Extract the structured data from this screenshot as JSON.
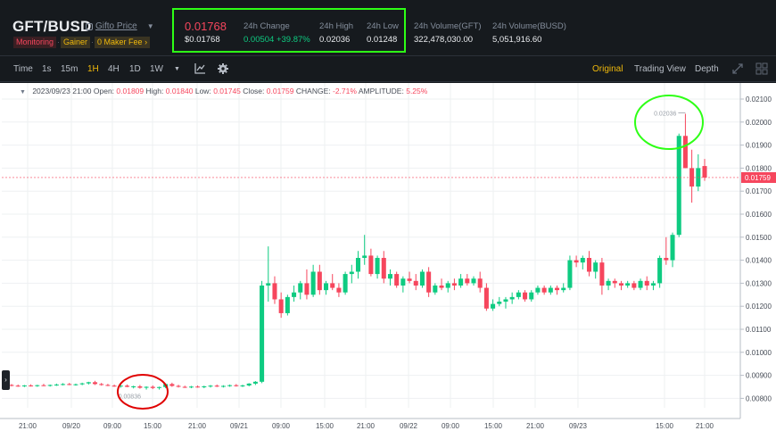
{
  "header": {
    "pair": "GFT/BUSD",
    "coin_name": "Gifto Price",
    "tags": {
      "monitoring": "Monitoring",
      "gainer": "Gainer",
      "fee": "0 Maker Fee"
    },
    "price": "0.01768",
    "price_usd": "$0.01768",
    "change_label": "24h Change",
    "change_value": "0.00504 +39.87%",
    "high_label": "24h High",
    "high_value": "0.02036",
    "low_label": "24h Low",
    "low_value": "0.01248",
    "vol_gft_label": "24h Volume(GFT)",
    "vol_gft_value": "322,478,030.00",
    "vol_busd_label": "24h Volume(BUSD)",
    "vol_busd_value": "5,051,916.60"
  },
  "toolbar": {
    "intervals": [
      "Time",
      "1s",
      "15m",
      "1H",
      "4H",
      "1D",
      "1W"
    ],
    "active_interval": "1H",
    "views": [
      "Original",
      "Trading View",
      "Depth"
    ],
    "active_view": "Original"
  },
  "ohlc_bar": {
    "date": "2023/09/23 21:00",
    "open_label": "Open:",
    "open": "0.01809",
    "high_label": "High:",
    "high": "0.01840",
    "low_label": "Low:",
    "low": "0.01745",
    "close_label": "Close:",
    "close": "0.01759",
    "change_label": "CHANGE:",
    "change": "-2.71%",
    "amplitude_label": "AMPLITUDE:",
    "amplitude": "5.25%"
  },
  "colors": {
    "up": "#0ecb81",
    "down": "#f6465d",
    "highlight": "#2eff16",
    "annotation_red": "#e00000"
  },
  "chart_data": {
    "type": "candlestick",
    "y_ticks": [
      "0.02100",
      "0.02000",
      "0.01900",
      "0.01800",
      "0.01700",
      "0.01600",
      "0.01500",
      "0.01400",
      "0.01300",
      "0.01200",
      "0.01100",
      "0.01000",
      "0.00900",
      "0.00800"
    ],
    "ylim": [
      0.0077,
      0.0213
    ],
    "x_ticks": [
      "21:00",
      "09/20",
      "09:00",
      "15:00",
      "21:00",
      "09/21",
      "09:00",
      "15:00",
      "21:00",
      "09/22",
      "09:00",
      "15:00",
      "21:00",
      "09/23",
      "15:00",
      "21:00"
    ],
    "current_price_label": "0.01759",
    "high_marker_label": "0.02036",
    "low_marker_label": "0.00836",
    "candles": [
      [
        0.00858,
        0.00862,
        0.00852,
        0.00855
      ],
      [
        0.00855,
        0.0086,
        0.0085,
        0.00853
      ],
      [
        0.00853,
        0.00858,
        0.00849,
        0.00856
      ],
      [
        0.00856,
        0.00861,
        0.00851,
        0.00854
      ],
      [
        0.00854,
        0.00859,
        0.0085,
        0.00857
      ],
      [
        0.00857,
        0.00863,
        0.00853,
        0.00855
      ],
      [
        0.00855,
        0.0086,
        0.00851,
        0.00858
      ],
      [
        0.00858,
        0.00864,
        0.00854,
        0.0086
      ],
      [
        0.0086,
        0.00866,
        0.00856,
        0.00862
      ],
      [
        0.00862,
        0.00867,
        0.00857,
        0.00859
      ],
      [
        0.00859,
        0.00864,
        0.00855,
        0.00861
      ],
      [
        0.00861,
        0.00868,
        0.00857,
        0.00865
      ],
      [
        0.00865,
        0.00872,
        0.0086,
        0.0087
      ],
      [
        0.0087,
        0.00876,
        0.00858,
        0.00862
      ],
      [
        0.00862,
        0.00867,
        0.00855,
        0.00858
      ],
      [
        0.00858,
        0.00863,
        0.00853,
        0.00855
      ],
      [
        0.00855,
        0.0086,
        0.0085,
        0.00852
      ],
      [
        0.00852,
        0.00858,
        0.00846,
        0.00855
      ],
      [
        0.00855,
        0.0086,
        0.00848,
        0.0085
      ],
      [
        0.0085,
        0.00855,
        0.00843,
        0.00852
      ],
      [
        0.00852,
        0.00858,
        0.00842,
        0.00846
      ],
      [
        0.00846,
        0.00852,
        0.00838,
        0.0085
      ],
      [
        0.0085,
        0.00856,
        0.0084,
        0.00845
      ],
      [
        0.00845,
        0.00851,
        0.00838,
        0.00849
      ],
      [
        0.00849,
        0.00865,
        0.00844,
        0.00862
      ],
      [
        0.00862,
        0.00868,
        0.0085,
        0.00854
      ],
      [
        0.00854,
        0.00859,
        0.00847,
        0.0085
      ],
      [
        0.0085,
        0.00855,
        0.00845,
        0.00848
      ],
      [
        0.00848,
        0.00854,
        0.00844,
        0.00851
      ],
      [
        0.00851,
        0.00856,
        0.00846,
        0.00849
      ],
      [
        0.00849,
        0.00855,
        0.00844,
        0.00852
      ],
      [
        0.00852,
        0.00858,
        0.00847,
        0.00855
      ],
      [
        0.00855,
        0.0086,
        0.00849,
        0.00851
      ],
      [
        0.00851,
        0.00857,
        0.00847,
        0.00854
      ],
      [
        0.00854,
        0.0086,
        0.0085,
        0.00857
      ],
      [
        0.00857,
        0.00862,
        0.00851,
        0.00853
      ],
      [
        0.00853,
        0.00859,
        0.00849,
        0.00856
      ],
      [
        0.00856,
        0.00866,
        0.00852,
        0.00864
      ],
      [
        0.00864,
        0.00875,
        0.00858,
        0.00872
      ],
      [
        0.00872,
        0.0131,
        0.00866,
        0.0129
      ],
      [
        0.0129,
        0.0146,
        0.0122,
        0.013
      ],
      [
        0.013,
        0.0133,
        0.0121,
        0.0123
      ],
      [
        0.0123,
        0.0126,
        0.0115,
        0.0117
      ],
      [
        0.0117,
        0.0125,
        0.0116,
        0.0124
      ],
      [
        0.0124,
        0.0129,
        0.0122,
        0.0126
      ],
      [
        0.0126,
        0.0131,
        0.0123,
        0.013
      ],
      [
        0.013,
        0.0136,
        0.0123,
        0.0125
      ],
      [
        0.0125,
        0.0138,
        0.0124,
        0.0135
      ],
      [
        0.0135,
        0.0138,
        0.0125,
        0.0127
      ],
      [
        0.0127,
        0.0131,
        0.0125,
        0.013
      ],
      [
        0.013,
        0.0134,
        0.0127,
        0.0128
      ],
      [
        0.0128,
        0.013,
        0.0124,
        0.0126
      ],
      [
        0.0126,
        0.0135,
        0.0125,
        0.0134
      ],
      [
        0.0134,
        0.0138,
        0.013,
        0.0135
      ],
      [
        0.0135,
        0.0144,
        0.0132,
        0.0141
      ],
      [
        0.0141,
        0.0151,
        0.0138,
        0.0142
      ],
      [
        0.0142,
        0.0145,
        0.0133,
        0.0134
      ],
      [
        0.0134,
        0.0142,
        0.0132,
        0.0141
      ],
      [
        0.0141,
        0.0144,
        0.013,
        0.0132
      ],
      [
        0.0132,
        0.0136,
        0.0129,
        0.0134
      ],
      [
        0.0134,
        0.0135,
        0.0128,
        0.0129
      ],
      [
        0.0129,
        0.0133,
        0.0126,
        0.0132
      ],
      [
        0.0132,
        0.0135,
        0.013,
        0.0131
      ],
      [
        0.0131,
        0.0134,
        0.0127,
        0.0129
      ],
      [
        0.0129,
        0.0136,
        0.0128,
        0.0135
      ],
      [
        0.0135,
        0.0137,
        0.0124,
        0.0126
      ],
      [
        0.0126,
        0.013,
        0.0125,
        0.0129
      ],
      [
        0.0129,
        0.0132,
        0.0127,
        0.0128
      ],
      [
        0.0128,
        0.0131,
        0.0126,
        0.013
      ],
      [
        0.013,
        0.0132,
        0.0127,
        0.0129
      ],
      [
        0.0129,
        0.0134,
        0.0128,
        0.0132
      ],
      [
        0.0132,
        0.0134,
        0.0129,
        0.013
      ],
      [
        0.013,
        0.0133,
        0.0129,
        0.0132
      ],
      [
        0.0132,
        0.0135,
        0.0126,
        0.0128
      ],
      [
        0.0128,
        0.013,
        0.0118,
        0.0119
      ],
      [
        0.0119,
        0.0123,
        0.0118,
        0.0121
      ],
      [
        0.0121,
        0.0124,
        0.012,
        0.0122
      ],
      [
        0.0122,
        0.0124,
        0.0119,
        0.0123
      ],
      [
        0.0123,
        0.0126,
        0.0121,
        0.0124
      ],
      [
        0.0124,
        0.0127,
        0.0123,
        0.0126
      ],
      [
        0.0126,
        0.0127,
        0.0122,
        0.0123
      ],
      [
        0.0123,
        0.0127,
        0.0122,
        0.0126
      ],
      [
        0.0126,
        0.0129,
        0.0125,
        0.0128
      ],
      [
        0.0128,
        0.0129,
        0.0125,
        0.0126
      ],
      [
        0.0126,
        0.0129,
        0.0125,
        0.0128
      ],
      [
        0.0128,
        0.0129,
        0.0125,
        0.0127
      ],
      [
        0.0127,
        0.013,
        0.0126,
        0.0128
      ],
      [
        0.0128,
        0.0142,
        0.0127,
        0.014
      ],
      [
        0.014,
        0.0142,
        0.0137,
        0.0139
      ],
      [
        0.0139,
        0.0142,
        0.0136,
        0.0141
      ],
      [
        0.0141,
        0.0144,
        0.0133,
        0.0135
      ],
      [
        0.0135,
        0.014,
        0.0132,
        0.0139
      ],
      [
        0.0139,
        0.0141,
        0.0125,
        0.0129
      ],
      [
        0.0129,
        0.0132,
        0.0127,
        0.0131
      ],
      [
        0.0131,
        0.0132,
        0.0128,
        0.013
      ],
      [
        0.013,
        0.0131,
        0.0127,
        0.0129
      ],
      [
        0.0129,
        0.0131,
        0.0128,
        0.013
      ],
      [
        0.013,
        0.0131,
        0.0127,
        0.0128
      ],
      [
        0.0128,
        0.0132,
        0.0127,
        0.0131
      ],
      [
        0.0131,
        0.0133,
        0.0127,
        0.0129
      ],
      [
        0.0129,
        0.0131,
        0.0127,
        0.013
      ],
      [
        0.013,
        0.0142,
        0.0128,
        0.0141
      ],
      [
        0.0141,
        0.015,
        0.0138,
        0.014
      ],
      [
        0.014,
        0.0152,
        0.0137,
        0.0151
      ],
      [
        0.0151,
        0.0195,
        0.015,
        0.0194
      ],
      [
        0.0194,
        0.02036,
        0.018,
        0.018
      ],
      [
        0.018,
        0.0188,
        0.0165,
        0.0172
      ],
      [
        0.0172,
        0.0186,
        0.017,
        0.018
      ],
      [
        0.01809,
        0.0184,
        0.01745,
        0.01759
      ]
    ]
  }
}
